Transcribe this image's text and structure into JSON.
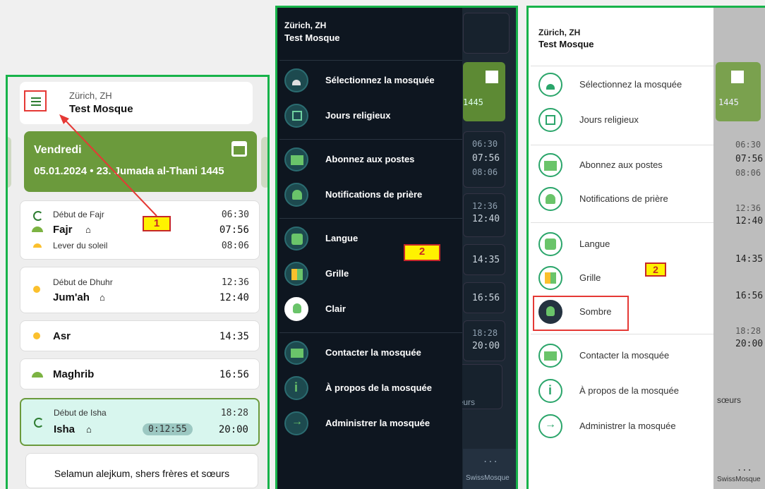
{
  "panel1": {
    "location": "Zürich, ZH",
    "mosque": "Test Mosque",
    "day_name": "Vendredi",
    "date": "05.01.2024 • 23. Jumada al-Thani 1445",
    "prayers": [
      {
        "sub": "Début de Fajr",
        "sub_time": "06:30",
        "name": "Fajr",
        "time": "07:56",
        "extra": "Lever du soleil",
        "extra_time": "08:06"
      },
      {
        "sub": "Début de Dhuhr",
        "sub_time": "12:36",
        "name": "Jum'ah",
        "time": "12:40"
      },
      {
        "name": "Asr",
        "time": "14:35"
      },
      {
        "name": "Maghrib",
        "time": "16:56"
      },
      {
        "sub": "Début de Isha",
        "sub_time": "18:28",
        "name": "Isha",
        "time": "20:00",
        "countdown": "0:12:55"
      }
    ],
    "greeting": "Selamun alejkum, shers frères et sœurs",
    "marker1": "1"
  },
  "panel2": {
    "location": "Zürich, ZH",
    "mosque": "Test Mosque",
    "items": [
      "Sélectionnez la mosquée",
      "Jours religieux",
      "Abonnez aux postes",
      "Notifications de prière",
      "Langue",
      "Grille",
      "Clair",
      "Contacter la mosquée",
      "À propos de la mosquée",
      "Administrer la mosquée"
    ],
    "marker2": "2",
    "bg_times": [
      "06:30",
      "07:56",
      "08:06",
      "12:36",
      "12:40",
      "14:35",
      "16:56",
      "18:28",
      "20:00"
    ],
    "bg_date": "1445",
    "bg_text": "sœurs",
    "bg_footer": "SwissMosque",
    "bg_dots": "..."
  },
  "panel3": {
    "location": "Zürich, ZH",
    "mosque": "Test Mosque",
    "items": [
      "Sélectionnez la mosquée",
      "Jours religieux",
      "Abonnez aux postes",
      "Notifications de prière",
      "Langue",
      "Grille",
      "Sombre",
      "Contacter la mosquée",
      "À propos de la mosquée",
      "Administrer la mosquée"
    ],
    "marker2": "2",
    "bg_times": [
      "06:30",
      "07:56",
      "08:06",
      "12:36",
      "12:40",
      "14:35",
      "16:56",
      "18:28",
      "20:00"
    ],
    "bg_date": "1445",
    "bg_text": "sœurs",
    "bg_footer": "SwissMosque",
    "bg_dots": "..."
  },
  "colors": {
    "accent": "#17b34a",
    "day_card": "#6b9a3c",
    "marker": "#fff200",
    "arrow": "#e53935"
  }
}
